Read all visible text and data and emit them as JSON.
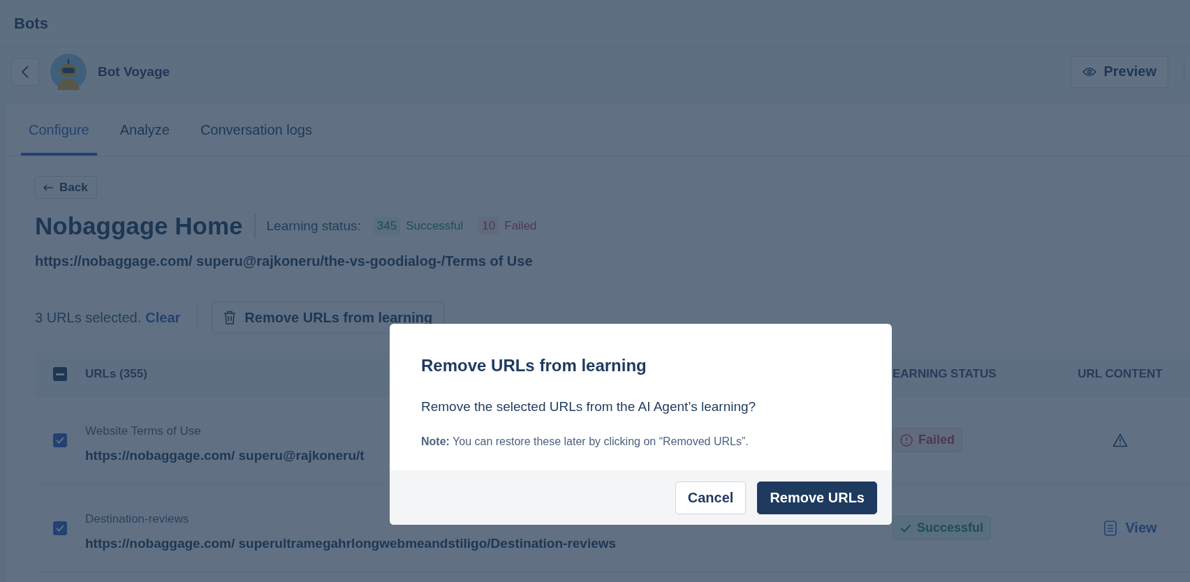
{
  "header": {
    "title": "Bots"
  },
  "bot_bar": {
    "name": "Bot Voyage",
    "preview_button": "Preview"
  },
  "tabs": [
    {
      "label": "Configure",
      "selected": true
    },
    {
      "label": "Analyze",
      "selected": false
    },
    {
      "label": "Conversation logs",
      "selected": false
    }
  ],
  "back_button": "Back",
  "page": {
    "title": "Nobaggage Home",
    "learning_status_label": "Learning status:",
    "successful_count": "345",
    "successful_label": "Successful",
    "failed_count": "10",
    "failed_label": "Failed",
    "url": "https://nobaggage.com/ superu@rajkoneru/the-vs-goodialog-/Terms of Use"
  },
  "selection_bar": {
    "text": "3 URLs selected.",
    "clear_link": "Clear",
    "remove_button": "Remove URLs from learning"
  },
  "table": {
    "header_checkbox": {
      "indeterminate": true
    },
    "columns": [
      {
        "label": "URLs (355)"
      },
      {
        "label": "EARNING STATUS"
      },
      {
        "label": "URL CONTENT"
      }
    ],
    "rows": [
      {
        "checked": true,
        "title": "Website Terms of Use",
        "url": "https://nobaggage.com/ superu@rajkoneru/t",
        "status": {
          "kind": "failed",
          "label": "Failed"
        },
        "content": {
          "kind": "warning"
        }
      },
      {
        "checked": true,
        "title": "Destination-reviews",
        "url": "https://nobaggage.com/ superultramegahrlongwebmeandstiligo/Destination-reviews",
        "status": {
          "kind": "successful",
          "label": "Successful"
        },
        "content": {
          "kind": "link",
          "label": "View"
        }
      }
    ]
  },
  "dialog": {
    "title": "Remove URLs from learning",
    "message": "Remove the selected URLs from the AI Agent’s learning?",
    "note": "**Note:** You can restore these later by clicking on “Removed URLs”.",
    "buttons": [
      {
        "label": "Cancel",
        "kind": "secondary"
      },
      {
        "label": "Remove URLs",
        "kind": "primary"
      }
    ]
  }
}
